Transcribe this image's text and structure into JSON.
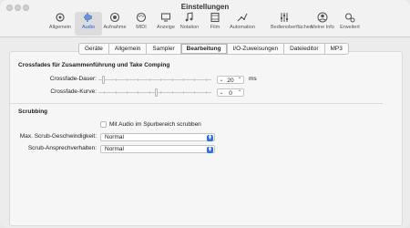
{
  "window": {
    "title": "Einstellungen"
  },
  "toolbar": {
    "items": [
      {
        "label": "Allgemein",
        "icon": "gear-icon"
      },
      {
        "label": "Audio",
        "icon": "waveform-icon",
        "active": true
      },
      {
        "label": "Aufnahme",
        "icon": "record-icon"
      },
      {
        "label": "MIDI",
        "icon": "midi-icon"
      },
      {
        "label": "Anzeige",
        "icon": "display-icon"
      },
      {
        "label": "Notation",
        "icon": "notes-icon"
      },
      {
        "label": "Film",
        "icon": "film-icon"
      },
      {
        "label": "Automation",
        "icon": "automation-icon"
      },
      {
        "label": "Bedienoberflächen",
        "icon": "sliders-icon"
      },
      {
        "label": "Meine Info",
        "icon": "person-icon"
      },
      {
        "label": "Erweitert",
        "icon": "advanced-gears-icon"
      }
    ]
  },
  "tabs": [
    "Geräte",
    "Allgemein",
    "Sampler",
    "Bearbeitung",
    "I/O-Zuweisungen",
    "Dateieditor",
    "MP3"
  ],
  "active_tab": "Bearbeitung",
  "crossfade": {
    "title": "Crossfades für Zusammenführung und Take Comping",
    "duration": {
      "label": "Crossfade-Dauer:",
      "value": "20",
      "unit": "ms",
      "level": 0.0
    },
    "curve": {
      "label": "Crossfade-Kurve:",
      "value": "0",
      "level": 0.5
    }
  },
  "scrubbing": {
    "title": "Scrubbing",
    "checkbox_label": "Mit Audio im Spurbereich scrubben",
    "checked": false,
    "max_speed": {
      "label": "Max. Scrub-Geschwindigkeit:",
      "value": "Normal"
    },
    "response": {
      "label": "Scrub-Ansprechverhalten:",
      "value": "Normal"
    }
  }
}
